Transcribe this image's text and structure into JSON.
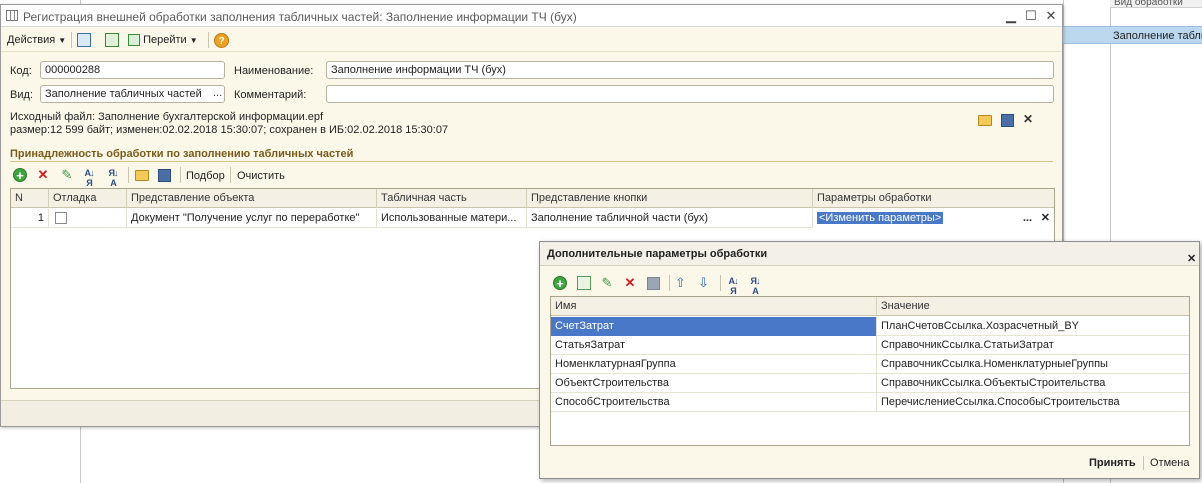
{
  "background": {
    "column_header": "Вид обработки",
    "selected_row_text": "Заполнение таблич"
  },
  "main": {
    "title": "Регистрация внешней обработки заполнения табличных частей: Заполнение  информации ТЧ (бух)",
    "toolbar": {
      "actions_label": "Действия",
      "goto_label": "Перейти"
    },
    "form": {
      "code_label": "Код:",
      "code_value": "000000288",
      "name_label": "Наименование:",
      "name_value": "Заполнение  информации ТЧ (бух)",
      "kind_label": "Вид:",
      "kind_value": "Заполнение табличных частей",
      "comment_label": "Комментарий:",
      "comment_value": "",
      "source_line1": "Исходный файл: Заполнение бухгалтерской информации.epf",
      "source_line2": "размер:12 599 байт; изменен:02.02.2018 15:30:07; сохранен в ИБ:02.02.2018 15:30:07"
    },
    "section_title": "Принадлежность обработки по заполнению табличных частей",
    "table_toolbar": {
      "pick_label": "Подбор",
      "clear_label": "Очистить"
    },
    "table": {
      "columns": [
        "N",
        "Отладка",
        "Представление объекта",
        "Табличная часть",
        "Представление кнопки",
        "Параметры обработки"
      ],
      "rows": [
        {
          "n": "1",
          "debug_checked": false,
          "object": "Документ \"Получение услуг по переработке\"",
          "tabular_part": "Использованные матери...",
          "button": "Заполнение табличной части (бух)",
          "params": "<Изменить параметры>"
        }
      ]
    }
  },
  "dialog": {
    "title": "Дополнительные параметры обработки",
    "columns": [
      "Имя",
      "Значение"
    ],
    "rows": [
      {
        "name": "СчетЗатрат",
        "value": "ПланСчетовСсылка.Хозрасчетный_BY"
      },
      {
        "name": "СтатьяЗатрат",
        "value": "СправочникСсылка.СтатьиЗатрат"
      },
      {
        "name": "НоменклатурнаяГруппа",
        "value": "СправочникСсылка.НоменклатурныеГруппы"
      },
      {
        "name": "ОбъектСтроительства",
        "value": "СправочникСсылка.ОбъектыСтроительства"
      },
      {
        "name": "СпособСтроительства",
        "value": "ПеречислениеСсылка.СпособыСтроительства"
      }
    ],
    "ok_label": "Принять",
    "cancel_label": "Отмена"
  },
  "colors": {
    "form_bg": "#fbf8ea",
    "selection": "#4a78c8",
    "section_title": "#7a5a1a"
  }
}
